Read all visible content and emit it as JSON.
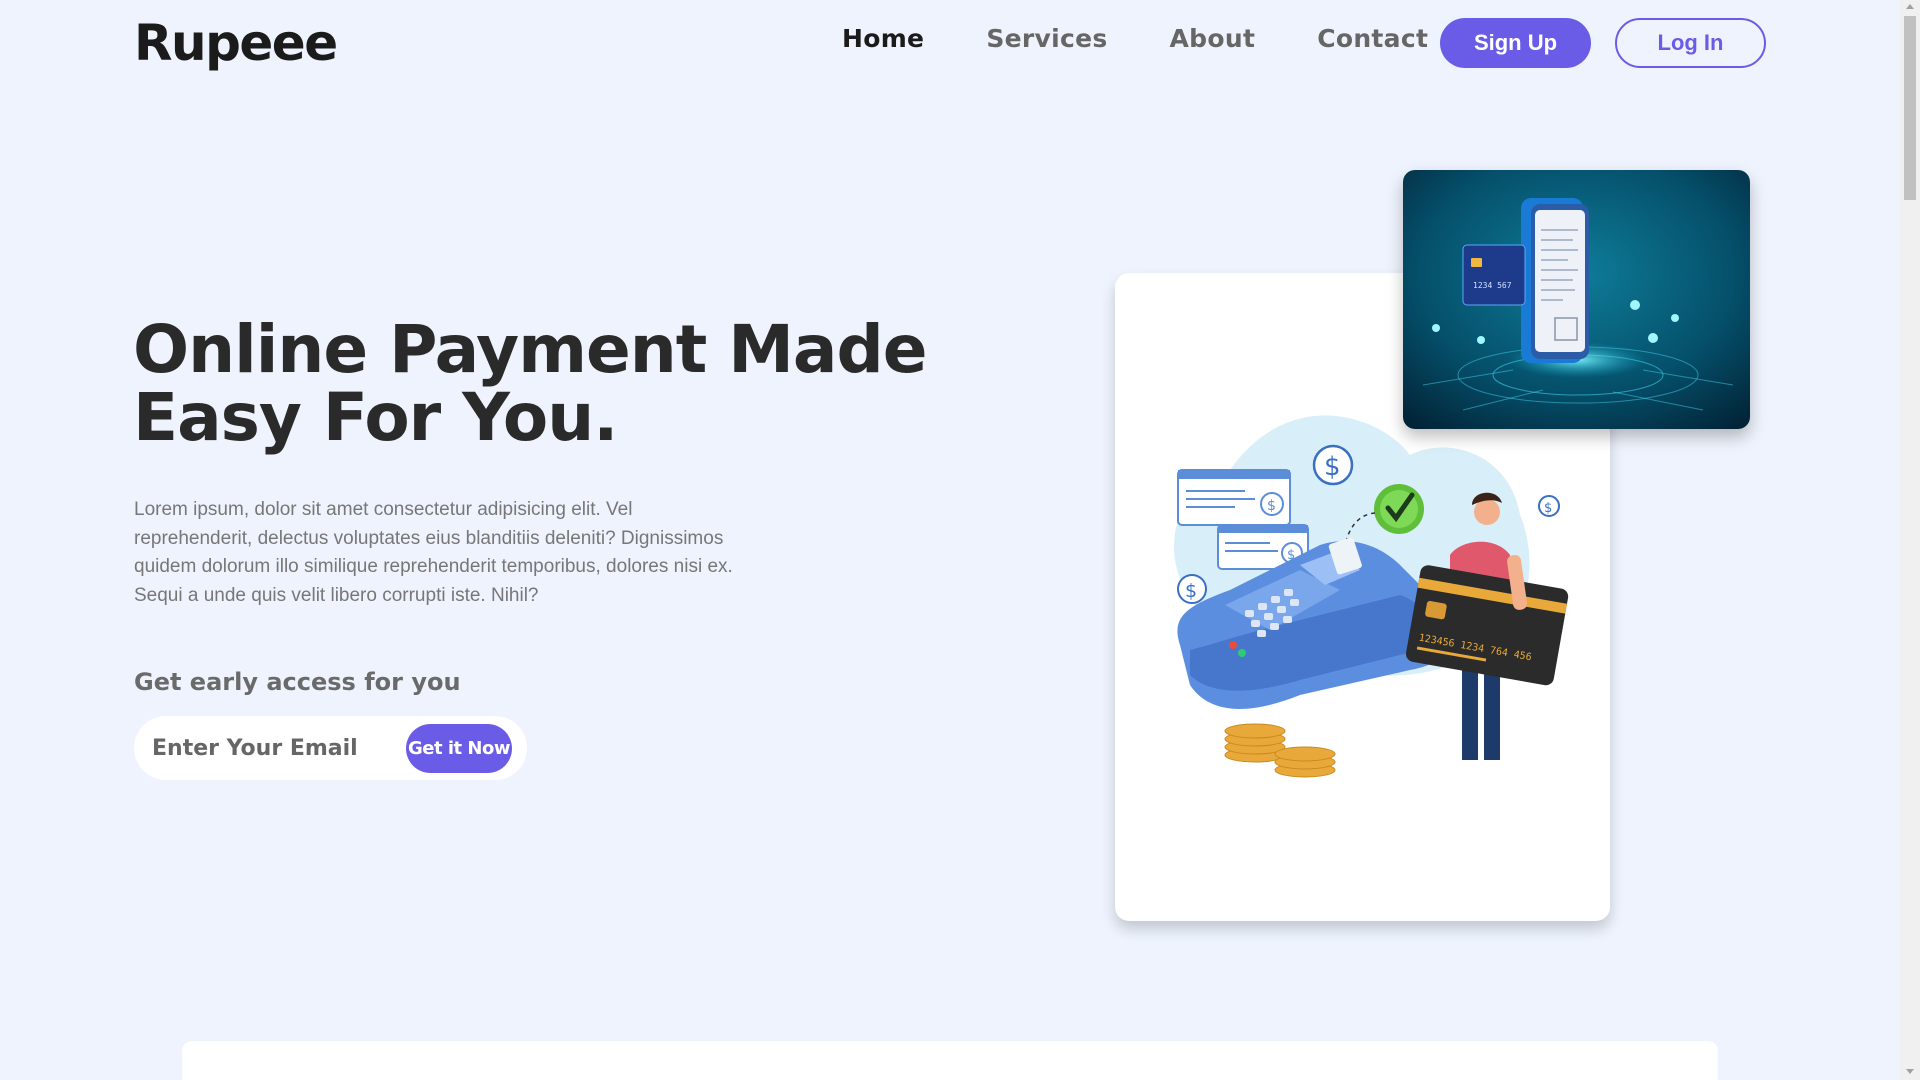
{
  "brand": {
    "name": "Rupeee"
  },
  "nav": {
    "items": [
      {
        "label": "Home",
        "active": true
      },
      {
        "label": "Services",
        "active": false
      },
      {
        "label": "About",
        "active": false
      },
      {
        "label": "Contact",
        "active": false
      }
    ],
    "signup_label": "Sign Up",
    "login_label": "Log In"
  },
  "hero": {
    "title_line1": "Online Payment Made",
    "title_line2": "Easy For You.",
    "description": "Lorem ipsum, dolor sit amet consectetur adipisicing elit. Vel reprehenderit, delectus voluptates eius blanditiis deleniti? Dignissimos quidem dolorum illo similique reprehenderit temporibus, dolores nisi ex. Sequi a unde quis velit libero corrupti iste. Nihil?",
    "early_access_title": "Get early access for you",
    "email_placeholder": "Enter Your Email",
    "cta_label": "Get it Now"
  },
  "illustration": {
    "card_number": "123456  1234  764  456",
    "phone_card_number": "1234 567"
  },
  "colors": {
    "accent": "#6b5ce7",
    "background": "#eef3fd"
  }
}
